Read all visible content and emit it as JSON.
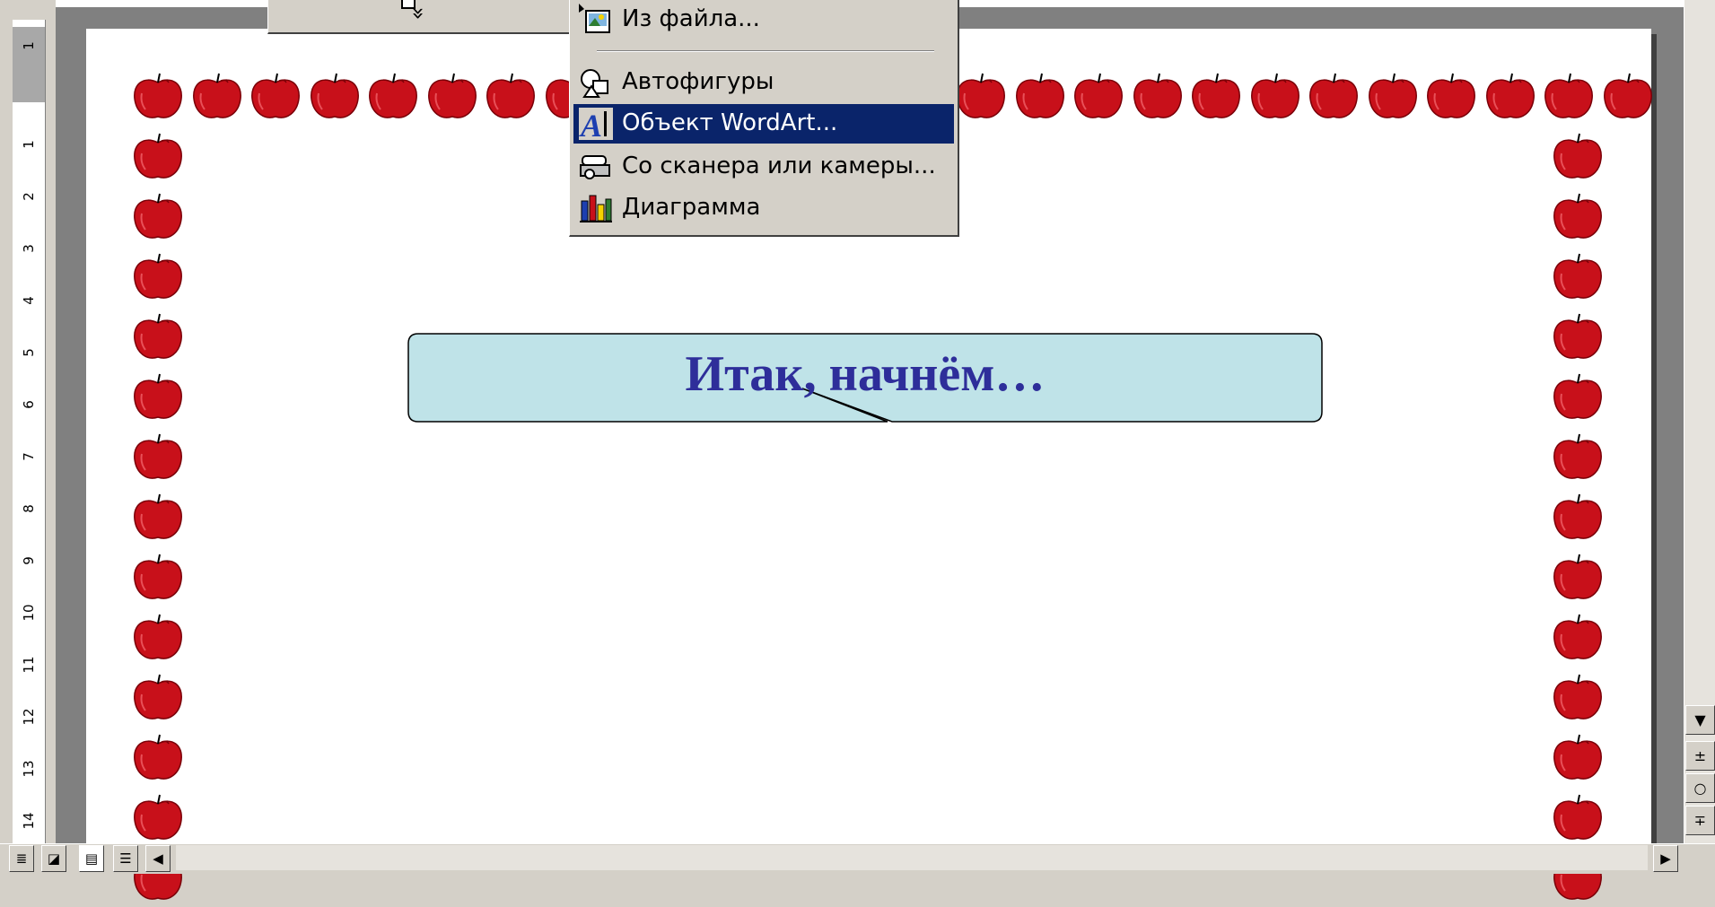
{
  "menu": {
    "items": [
      {
        "label": "Из файла...",
        "icon": "picture-from-file-icon",
        "selected": false
      },
      {
        "label": "Автофигуры",
        "icon": "autoshapes-icon",
        "selected": false
      },
      {
        "label": "Объект WordArt...",
        "icon": "wordart-icon",
        "selected": true
      },
      {
        "label": "Со сканера или камеры...",
        "icon": "scanner-camera-icon",
        "selected": false
      },
      {
        "label": "Диаграмма",
        "icon": "chart-icon",
        "selected": false
      }
    ],
    "expand_glyph": "»",
    "selection_color": "#0a246a"
  },
  "callout": {
    "text": "Итак, начнём…",
    "fill_color": "#bfe3e8",
    "text_color": "#2e2e9a"
  },
  "ruler": {
    "labels": [
      "1",
      "1",
      "2",
      "3",
      "4",
      "5",
      "6",
      "7",
      "8",
      "9",
      "10",
      "11",
      "12",
      "13",
      "14"
    ]
  },
  "scrollbar": {
    "down_glyph": "▼",
    "prev_glyph": "±",
    "browse_glyph": "○",
    "next_glyph": "∓",
    "left_glyph": "◀",
    "right_glyph": "▶"
  },
  "view_buttons": [
    "normal-view",
    "web-layout-view",
    "print-layout-view",
    "outline-view"
  ],
  "page_border": {
    "motif": "red-apple",
    "color": "#c8101a"
  }
}
